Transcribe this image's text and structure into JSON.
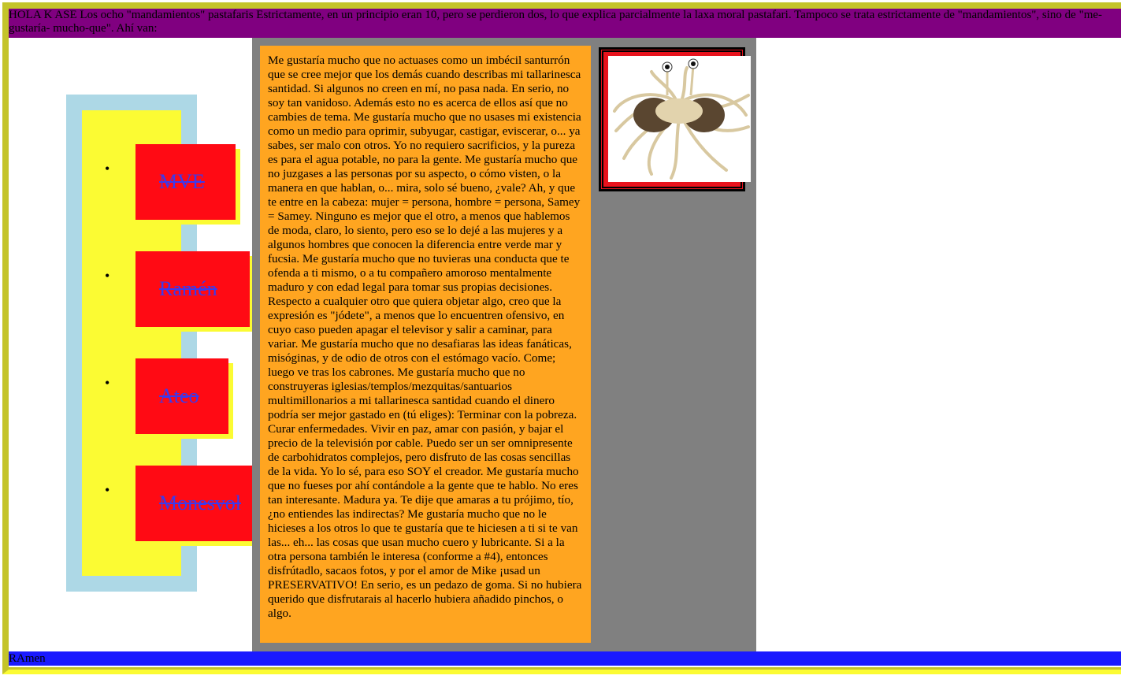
{
  "header": {
    "text": "HOLA K ASE Los ocho \"mandamientos\" pastafaris Estrictamente, en un principio eran 10, pero se perdieron dos, lo que explica parcialmente la laxa moral pastafari. Tampoco se trata estrictamente de \"mandamientos\", sino de \"me-gustaría- mucho-que\". Ahí van:"
  },
  "nav": {
    "items": [
      {
        "label": "MVE"
      },
      {
        "label": "Ramén"
      },
      {
        "label": "Ateo"
      },
      {
        "label": "Monesvol"
      }
    ]
  },
  "main": {
    "body": "Me gustaría mucho que no actuases como un imbécil santurrón que se cree mejor que los demás cuando describas mi tallarinesca santidad. Si algunos no creen en mí, no pasa nada. En serio, no soy tan vanidoso. Además esto no es acerca de ellos así que no cambies de tema. Me gustaría mucho que no usases mi existencia como un medio para oprimir, subyugar, castigar, eviscerar, o... ya sabes, ser malo con otros. Yo no requiero sacrificios, y la pureza es para el agua potable, no para la gente. Me gustaría mucho que no juzgases a las personas por su aspecto, o cómo visten, o la manera en que hablan, o... mira, solo sé bueno, ¿vale? Ah, y que te entre en la cabeza: mujer = persona, hombre = persona, Samey = Samey. Ninguno es mejor que el otro, a menos que hablemos de moda, claro, lo siento, pero eso se lo dejé a las mujeres y a algunos hombres que conocen la diferencia entre verde mar y fucsia. Me gustaría mucho que no tuvieras una conducta que te ofenda a ti mismo, o a tu compañero amoroso mentalmente maduro y con edad legal para tomar sus propias decisiones. Respecto a cualquier otro que quiera objetar algo, creo que la expresión es \"jódete\", a menos que lo encuentren ofensivo, en cuyo caso pueden apagar el televisor y salir a caminar, para variar. Me gustaría mucho que no desafiaras las ideas fanáticas, misóginas, y de odio de otros con el estómago vacío. Come; luego ve tras los cabrones. Me gustaría mucho que no construyeras iglesias/templos/mezquitas/santuarios multimillonarios a mi tallarinesca santidad cuando el dinero podría ser mejor gastado en (tú eliges): Terminar con la pobreza. Curar enfermedades. Vivir en paz, amar con pasión, y bajar el precio de la televisión por cable. Puedo ser un ser omnipresente de carbohidratos complejos, pero disfruto de las cosas sencillas de la vida. Yo lo sé, para eso SOY el creador. Me gustaría mucho que no fueses por ahí contándole a la gente que te hablo. No eres tan interesante. Madura ya. Te dije que amaras a tu prójimo, tío, ¿no entiendes las indirectas? Me gustaría mucho que no le hicieses a los otros lo que te gustaría que te hiciesen a ti si te van las... eh... las cosas que usan mucho cuero y lubricante. Si a la otra persona también le interesa (conforme a #4), entonces disfrútadlo, sacaos fotos, y por el amor de Mike ¡usad un PRESERVATIVO! En serio, es un pedazo de goma. Si no hubiera querido que disfrutarais al hacerlo hubiera añadido pinchos, o algo."
  },
  "image": {
    "icon": "flying-spaghetti-monster-image"
  },
  "footer": {
    "text": "RAmen"
  },
  "colors": {
    "header_bg": "#800080",
    "nav_outer_bg": "#add8e6",
    "nav_inner_bg": "#fbfb33",
    "nav_button_bg": "#ff0a14",
    "nav_link_text": "#3a3aee",
    "main_col_bg": "#808080",
    "text_box_bg": "#ffa520",
    "footer_bg": "#1a1aff",
    "frame_border": "#c4c42a"
  }
}
